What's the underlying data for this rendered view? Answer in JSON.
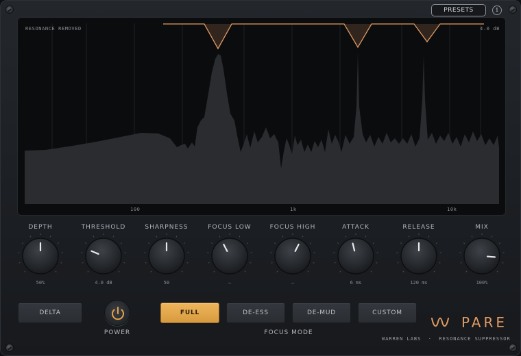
{
  "header": {
    "presets_label": "PRESETS",
    "info_label": "i"
  },
  "display": {
    "title": "RESONANCE REMOVED",
    "max_reduction": "4.0 dB",
    "freq_labels": [
      "100",
      "1k",
      "10k"
    ],
    "notch_color": "#e09a62"
  },
  "knobs": [
    {
      "label": "DEPTH",
      "value": "50%",
      "level": 0.5
    },
    {
      "label": "THRESHOLD",
      "value": "4.0 dB",
      "level": 0.25
    },
    {
      "label": "SHARPNESS",
      "value": "50",
      "level": 0.5
    },
    {
      "label": "FOCUS LOW",
      "value": "—",
      "level": 0.4
    },
    {
      "label": "FOCUS HIGH",
      "value": "—",
      "level": 0.6
    },
    {
      "label": "ATTACK",
      "value": "6 ms",
      "level": 0.45
    },
    {
      "label": "RELEASE",
      "value": "120 ms",
      "level": 0.5
    },
    {
      "label": "MIX",
      "value": "100%",
      "level": 0.85
    }
  ],
  "buttons": {
    "delta": "DELTA",
    "power": "POWER",
    "focus_modes": [
      {
        "label": "FULL",
        "active": true
      },
      {
        "label": "DE-ESS",
        "active": false
      },
      {
        "label": "DE-MUD",
        "active": false
      },
      {
        "label": "CUSTOM",
        "active": false
      }
    ],
    "focus_mode_label": "FOCUS MODE"
  },
  "brand": {
    "name": "PARE",
    "subtitle": "WARREN LABS  ·  RESONANCE SUPPRESSOR",
    "accent": "#e09a62"
  }
}
